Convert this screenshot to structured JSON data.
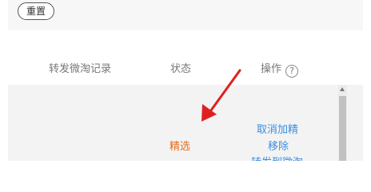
{
  "filter": {
    "reset_label": "重置"
  },
  "table": {
    "headers": {
      "record": "转发微淘记录",
      "status": "状态",
      "action": "操作",
      "help": "?"
    },
    "rows": [
      {
        "status": "精选",
        "actions": [
          "取消加精",
          "移除",
          "转发到微淘"
        ]
      }
    ]
  },
  "colors": {
    "status_featured": "#e36c1e",
    "link": "#3a8ee6",
    "annotation_arrow": "#e02020"
  }
}
